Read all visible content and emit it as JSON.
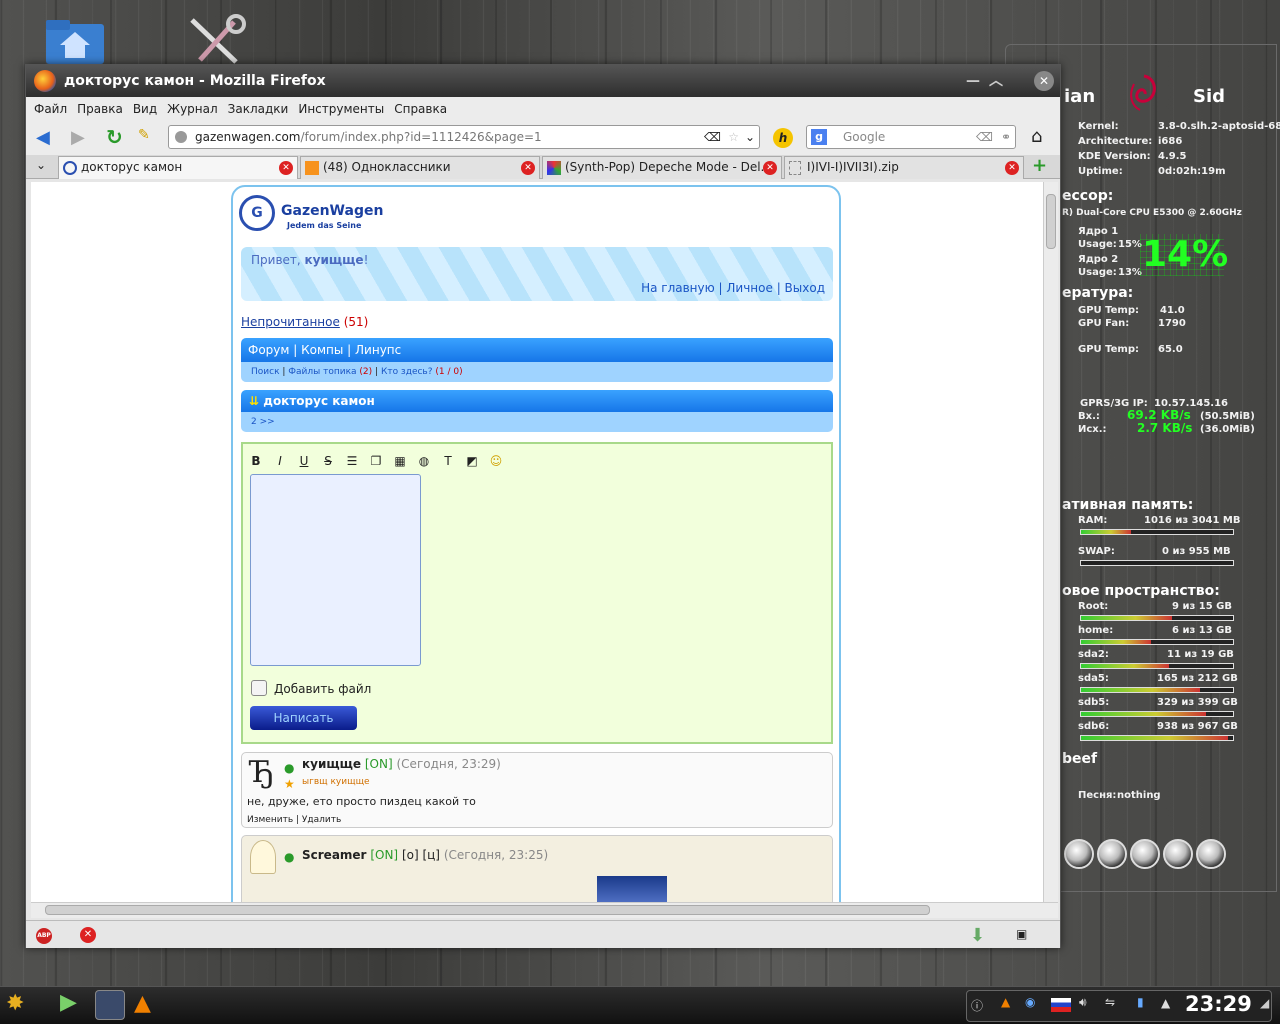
{
  "window": {
    "title": "докторус камон - Mozilla Firefox"
  },
  "menu": [
    "Файл",
    "Правка",
    "Вид",
    "Журнал",
    "Закладки",
    "Инструменты",
    "Справка"
  ],
  "url": {
    "domain": "gazenwagen.com",
    "path": "/forum/index.php?id=1112426&page=1"
  },
  "search": {
    "placeholder": "Google"
  },
  "tabs": [
    {
      "label": "докторус камон",
      "active": true
    },
    {
      "label": "(48) Одноклассники",
      "active": false
    },
    {
      "label": "(Synth-Pop) Depeche Mode - Del...",
      "active": false
    },
    {
      "label": "I)IVI-I)IVII3I).zip",
      "active": false
    }
  ],
  "forum": {
    "logo_title": "GazenWagen",
    "logo_sub": "Jedem das Seine",
    "greeting_prefix": "Привет, ",
    "greeting_user": "куищще",
    "greeting_suffix": "!",
    "nav_links": "На главную | Личное | Выход",
    "unread_label": "Непрочитанное",
    "unread_count": "(51)",
    "breadcrumb": "Форум | Компы | Линупс",
    "sub_search": "Поиск",
    "sub_files": "Файлы топика",
    "sub_files_count": "(2)",
    "sub_who": "Кто здесь?",
    "sub_who_count": "(1 / 0)",
    "topic_title": "докторус камон",
    "pages": "2 >>",
    "add_file": "Добавить файл",
    "submit": "Написать",
    "posts": [
      {
        "author": "куищще",
        "status": "[ON]",
        "time": "(Сегодня, 23:29)",
        "title": "ыгвщ куищще",
        "text": "не, друже, ето просто пиздец какой то",
        "actions": "Изменить | Удалить",
        "avatar": "Ђ"
      },
      {
        "author": "Screamer",
        "status": "[ON]",
        "extra": "[о] [ц]",
        "time": "(Сегодня, 23:25)"
      }
    ]
  },
  "conky": {
    "distro_left": "ian",
    "distro_right": "Sid",
    "kernel_l": "Kernel:",
    "kernel": "3.8-0.slh.2-aptosid-686",
    "arch_l": "Architecture:",
    "arch": "i686",
    "kde_l": "KDE Version:",
    "kde": "4.9.5",
    "uptime_l": "Uptime:",
    "uptime": "0d:02h:19m",
    "cpu_h": "ессор:",
    "cpu_model": "R) Dual-Core  CPU    E5300  @ 2.60GHz",
    "core1": "Ядро 1",
    "usage1_l": "Usage:",
    "usage1": "15%",
    "core2": "Ядро 2",
    "usage2_l": "Usage:",
    "usage2": "13%",
    "cpu_big": "14%",
    "temp_h": "ература:",
    "gputemp_l": "GPU Temp:",
    "gputemp": "41.0",
    "gpufan_l": "GPU Fan:",
    "gpufan": "1790",
    "gputemp2_l": "GPU Temp:",
    "gputemp2": "65.0",
    "ip_l": "GPRS/3G IP:",
    "ip": "10.57.145.16",
    "rx_l": "Вх.:",
    "rx": "69.2 KB/s",
    "rx_total": "(50.5MiB)",
    "tx_l": "Исх.:",
    "tx": "2.7 KB/s",
    "tx_total": "(36.0MiB)",
    "mem_h": "ативная память:",
    "ram_l": "RAM:",
    "ram": "1016 из 3041 MB",
    "ram_fill": 0.33,
    "swap_l": "SWAP:",
    "swap": "0 из 955 MB",
    "swap_fill": 0,
    "disk_h": "овое пространство:",
    "disks": [
      {
        "l": "Root:",
        "v": "9 из 15 GB",
        "fill": 0.6
      },
      {
        "l": "home:",
        "v": "6 из 13 GB",
        "fill": 0.46
      },
      {
        "l": "sda2:",
        "v": "11 из 19 GB",
        "fill": 0.58
      },
      {
        "l": "sda5:",
        "v": "165 из 212 GB",
        "fill": 0.78
      },
      {
        "l": "sdb5:",
        "v": "329 из 399 GB",
        "fill": 0.82
      },
      {
        "l": "sdb6:",
        "v": "938 из 967 GB",
        "fill": 0.97
      }
    ],
    "player_h": "beef",
    "song_l": "Песня:",
    "song": "nothing"
  },
  "clock": "23:29",
  "colors": {
    "accent": "#1676e8",
    "online": "#2a9a2a",
    "unread": "#cc0000",
    "conky_green": "#22ff22"
  }
}
